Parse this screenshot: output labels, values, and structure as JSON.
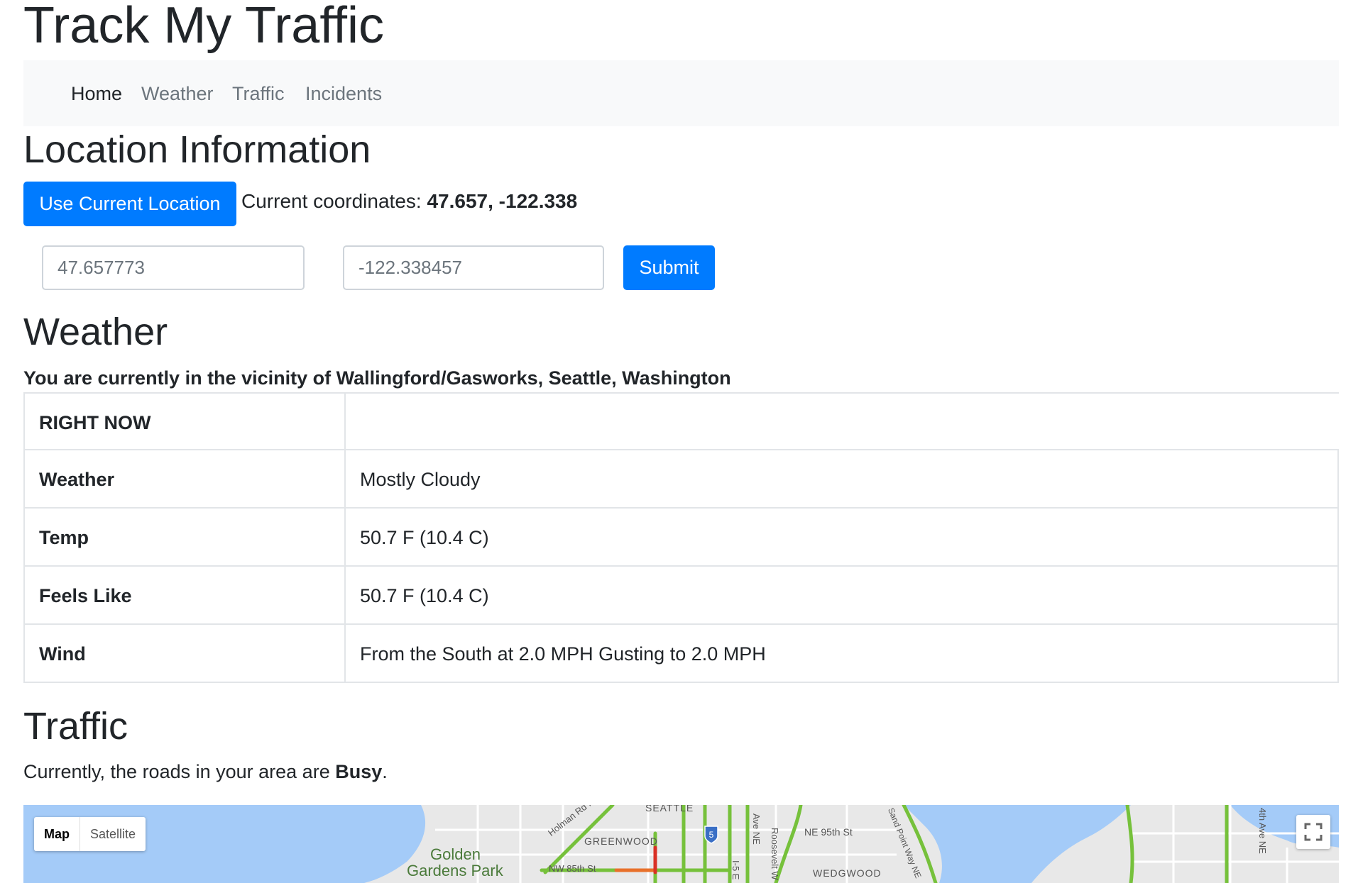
{
  "app": {
    "title": "Track My Traffic"
  },
  "nav": {
    "items": [
      {
        "label": "Home",
        "active": true
      },
      {
        "label": "Weather",
        "active": false
      },
      {
        "label": "Traffic",
        "active": false
      },
      {
        "label": "Incidents",
        "active": false
      }
    ]
  },
  "location": {
    "heading": "Location Information",
    "use_current_label": "Use Current Location",
    "coords_prefix": "Current coordinates:",
    "coords_value": "47.657, -122.338",
    "lat_placeholder": "47.657773",
    "lng_placeholder": "-122.338457",
    "submit_label": "Submit"
  },
  "weather": {
    "heading": "Weather",
    "vicinity": "You are currently in the vicinity of Wallingford/Gasworks, Seattle, Washington",
    "table_header": "RIGHT NOW",
    "rows": [
      {
        "label": "Weather",
        "value": "Mostly Cloudy"
      },
      {
        "label": "Temp",
        "value": "50.7 F (10.4 C)"
      },
      {
        "label": "Feels Like",
        "value": "50.7 F (10.4 C)"
      },
      {
        "label": "Wind",
        "value": "From the South at 2.0 MPH Gusting to 2.0 MPH"
      }
    ]
  },
  "traffic": {
    "heading": "Traffic",
    "status_prefix": "Currently, the roads in your area are",
    "status_value": "Busy",
    "status_suffix": "."
  },
  "map": {
    "type_options": [
      "Map",
      "Satellite"
    ],
    "selected_type": "Map",
    "labels": {
      "park_line1": "Golden",
      "park_line2": "Gardens Park",
      "greenwood": "GREENWOOD",
      "seattle": "SEATTLE",
      "holman": "Holman Rd NW",
      "nw85": "NW 85th St",
      "ne95": "NE 95th St",
      "wedgwood": "WEDGWOOD",
      "ave_ne": "Ave NE",
      "roosevelt": "Roosevelt W",
      "i5_shield": "5",
      "i5": "I-5 E",
      "sandpoint": "Sand Point Way NE",
      "fourth_ave": "4th Ave NE"
    },
    "colors": {
      "water": "#a4cbf8",
      "land": "#e8e8e8",
      "traffic_green": "#76c13b",
      "traffic_orange": "#e8702a",
      "traffic_red": "#d93025",
      "road": "#ffffff"
    }
  }
}
